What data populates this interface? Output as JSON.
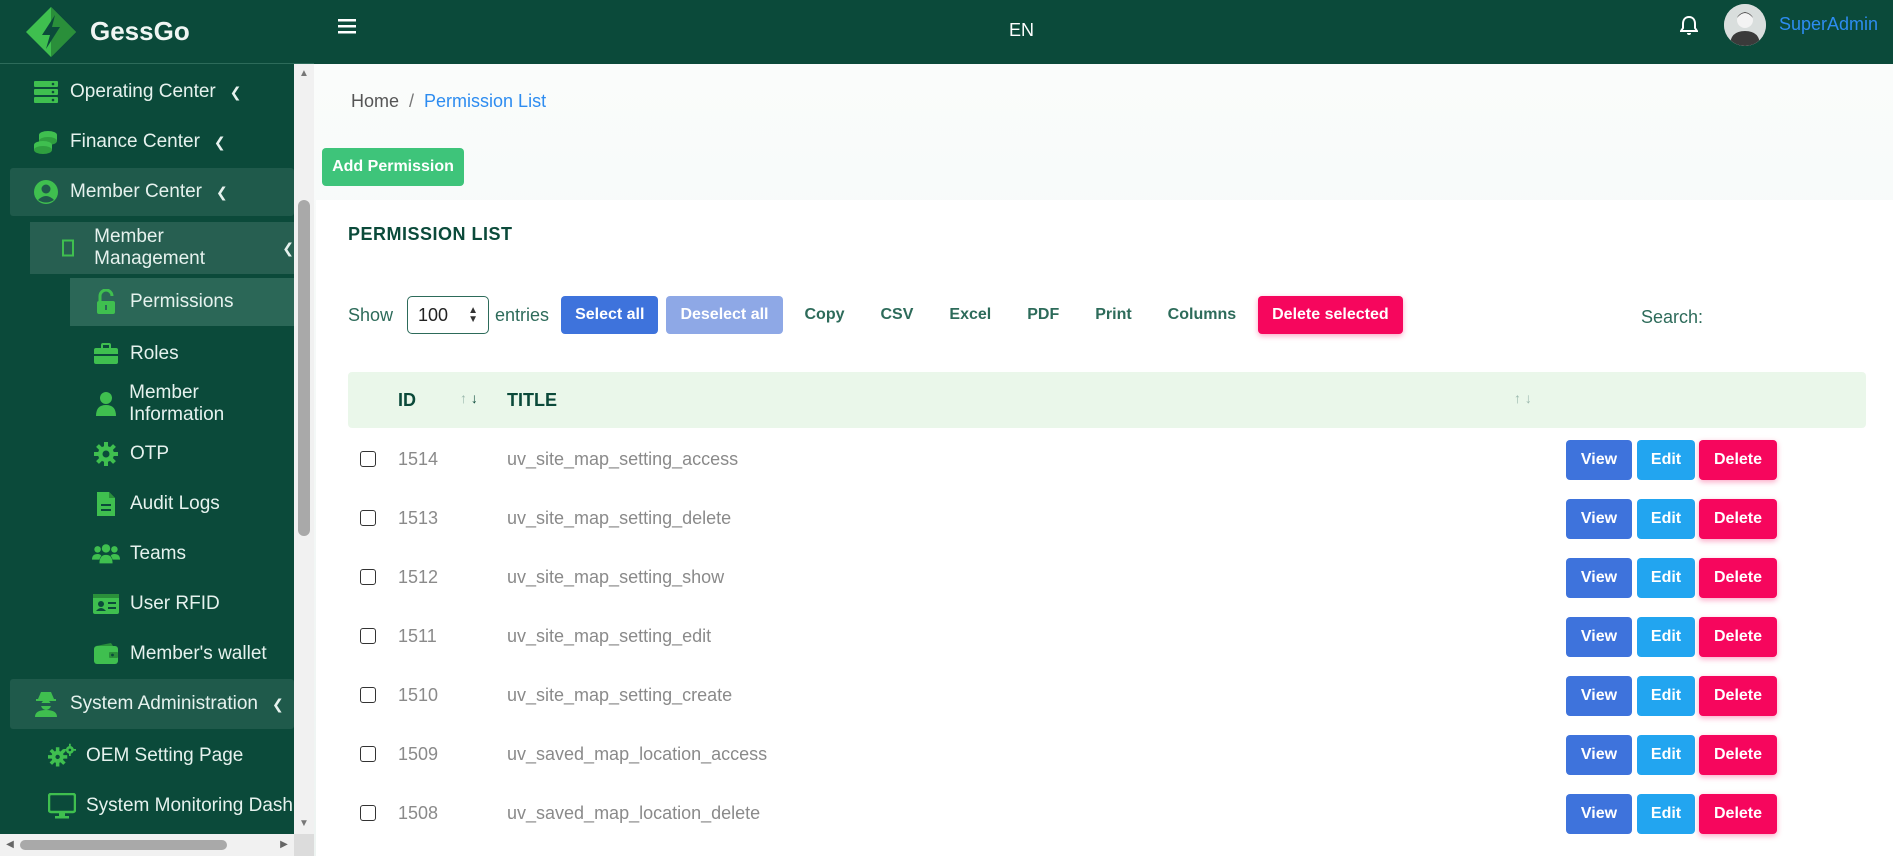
{
  "brand": {
    "name": "GessGo"
  },
  "sidebar": {
    "items": [
      {
        "label": "Operating Center",
        "icon": "server-icon",
        "level": 1
      },
      {
        "label": "Finance Center",
        "icon": "coins-icon",
        "level": 1
      },
      {
        "label": "Member Center",
        "icon": "user-circle-icon",
        "level": 1,
        "active": true
      },
      {
        "label": "Member Management",
        "icon": "square-outline-icon",
        "level": 2
      },
      {
        "label": "Permissions",
        "icon": "unlock-icon",
        "level": 3,
        "active": true
      },
      {
        "label": "Roles",
        "icon": "briefcase-icon",
        "level": 3
      },
      {
        "label": "Member Information",
        "icon": "user-icon",
        "level": 3
      },
      {
        "label": "OTP",
        "icon": "gear-icon",
        "level": 3
      },
      {
        "label": "Audit Logs",
        "icon": "file-icon",
        "level": 3
      },
      {
        "label": "Teams",
        "icon": "users-icon",
        "level": 3
      },
      {
        "label": "User RFID",
        "icon": "id-card-icon",
        "level": 3
      },
      {
        "label": "Member's wallet",
        "icon": "wallet-icon",
        "level": 3
      },
      {
        "label": "System Administration",
        "icon": "user-secret-icon",
        "level": 1
      },
      {
        "label": "OEM Setting Page",
        "icon": "gears-icon",
        "level": 1
      },
      {
        "label": "System Monitoring Dash",
        "icon": "monitor-icon",
        "level": 1
      }
    ]
  },
  "topbar": {
    "language": "EN",
    "user": "SuperAdmin"
  },
  "breadcrumb": {
    "home": "Home",
    "separator": "/",
    "current": "Permission List"
  },
  "page": {
    "add_button": "Add Permission",
    "card_title": "PERMISSION LIST",
    "show_label": "Show",
    "entries_value": "100",
    "entries_label": "entries",
    "select_all": "Select all",
    "deselect_all": "Deselect all",
    "copy": "Copy",
    "csv": "CSV",
    "excel": "Excel",
    "pdf": "PDF",
    "print": "Print",
    "columns": "Columns",
    "delete_selected": "Delete selected",
    "search_label": "Search:"
  },
  "table": {
    "headers": {
      "id": "ID",
      "title": "TITLE"
    },
    "actions": {
      "view": "View",
      "edit": "Edit",
      "delete": "Delete"
    },
    "rows": [
      {
        "id": "1514",
        "title": "uv_site_map_setting_access"
      },
      {
        "id": "1513",
        "title": "uv_site_map_setting_delete"
      },
      {
        "id": "1512",
        "title": "uv_site_map_setting_show"
      },
      {
        "id": "1511",
        "title": "uv_site_map_setting_edit"
      },
      {
        "id": "1510",
        "title": "uv_site_map_setting_create"
      },
      {
        "id": "1509",
        "title": "uv_saved_map_location_access"
      },
      {
        "id": "1508",
        "title": "uv_saved_map_location_delete"
      }
    ]
  },
  "colors": {
    "sidebar_bg": "#0b4a3a",
    "icon_green": "#3fbf4f",
    "primary": "#3e73dc",
    "info": "#22a5f0",
    "danger": "#f6065d",
    "success": "#3ec47a",
    "link": "#2d8cf0"
  }
}
